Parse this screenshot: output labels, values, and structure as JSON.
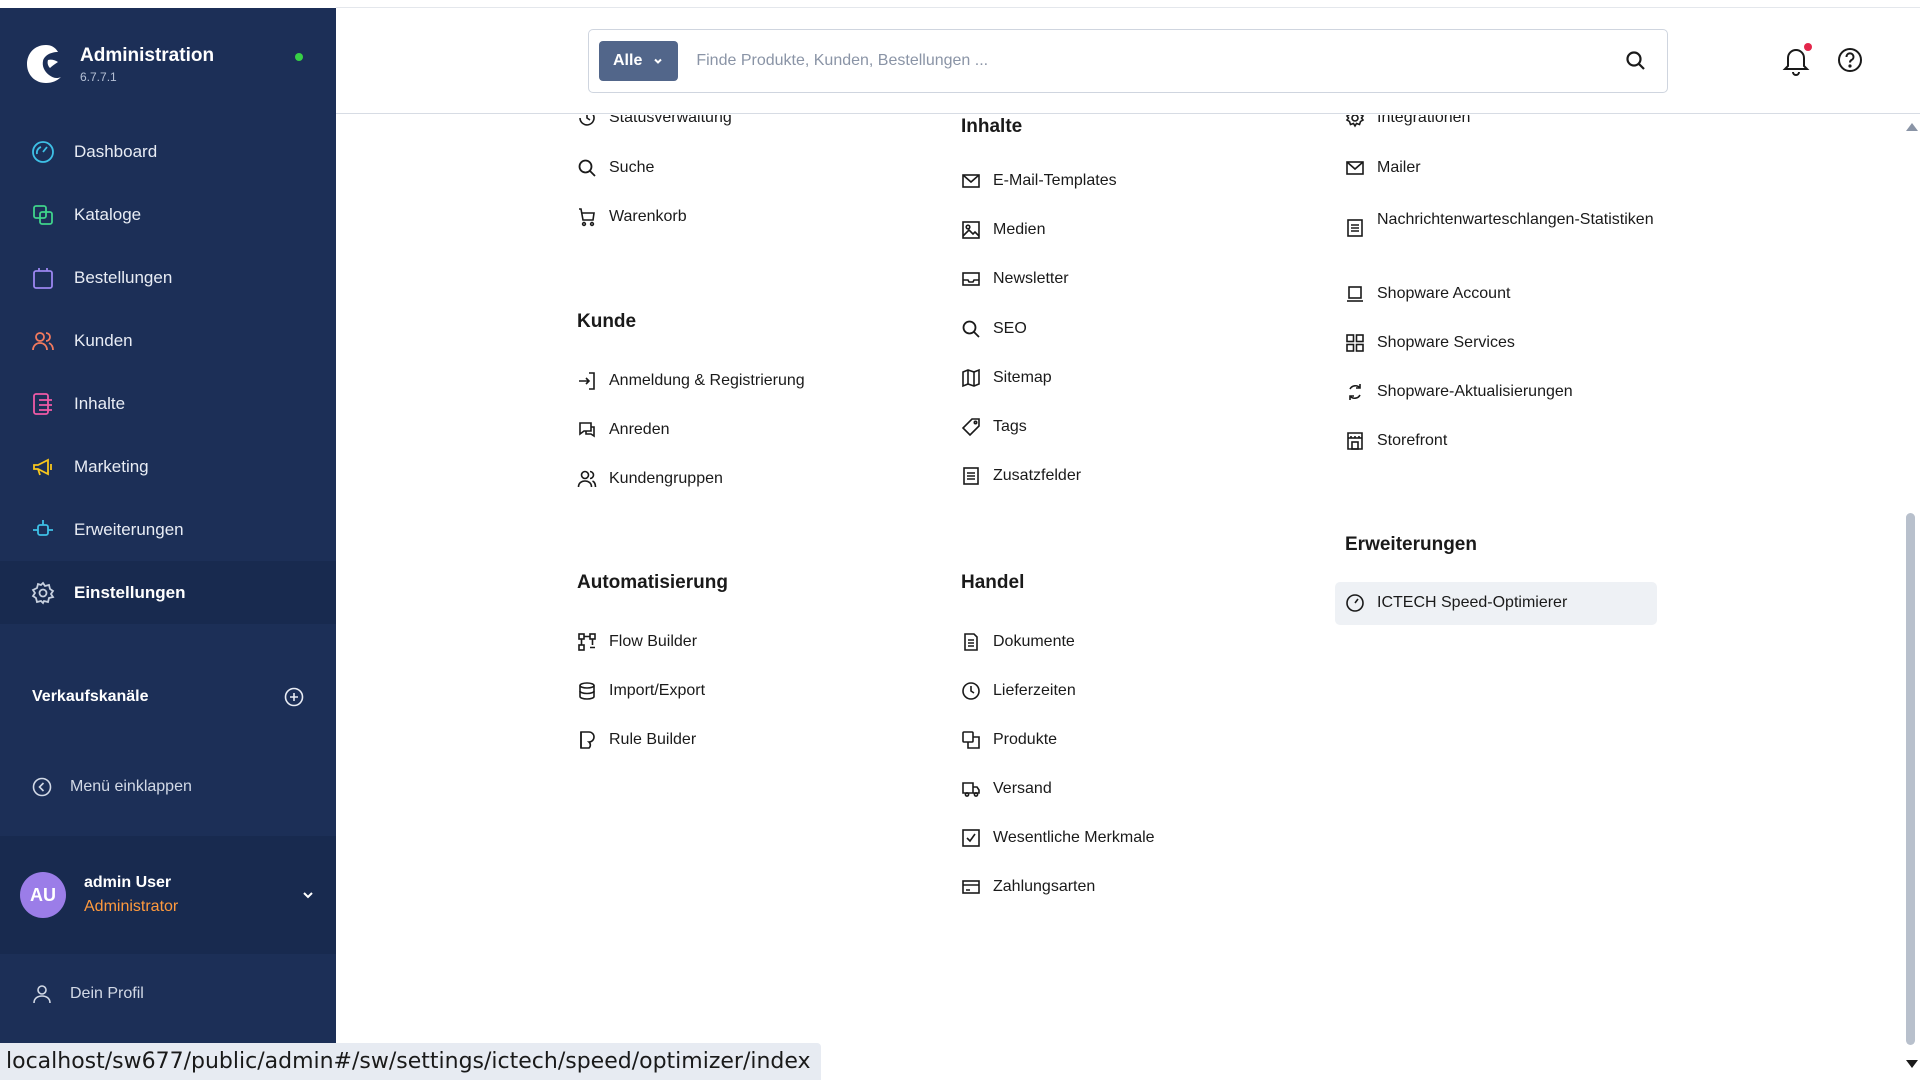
{
  "app": {
    "title": "Administration",
    "version": "6.7.7.1"
  },
  "nav": [
    {
      "label": "Dashboard",
      "icon": "dashboard-icon"
    },
    {
      "label": "Kataloge",
      "icon": "catalog-icon"
    },
    {
      "label": "Bestellungen",
      "icon": "orders-icon"
    },
    {
      "label": "Kunden",
      "icon": "customers-icon"
    },
    {
      "label": "Inhalte",
      "icon": "content-icon"
    },
    {
      "label": "Marketing",
      "icon": "marketing-icon"
    },
    {
      "label": "Erweiterungen",
      "icon": "extensions-icon"
    },
    {
      "label": "Einstellungen",
      "icon": "settings-icon",
      "active": true
    }
  ],
  "sidebar": {
    "channels_label": "Verkaufskanäle",
    "collapse_label": "Menü einklappen",
    "profile_label": "Dein Profil"
  },
  "user": {
    "initials": "AU",
    "name": "admin User",
    "role": "Administrator"
  },
  "search": {
    "filter_label": "Alle",
    "placeholder": "Finde Produkte, Kunden, Bestellungen ..."
  },
  "settings": {
    "col1": {
      "top_items": [
        "Statusverwaltung",
        "Suche",
        "Warenkorb"
      ],
      "kunde_title": "Kunde",
      "kunde_items": [
        "Anmeldung & Registrierung",
        "Anreden",
        "Kundengruppen"
      ],
      "auto_title": "Automatisierung",
      "auto_items": [
        "Flow Builder",
        "Import/Export",
        "Rule Builder"
      ]
    },
    "col2": {
      "inhalte_title": "Inhalte",
      "inhalte_items": [
        "E-Mail-Templates",
        "Medien",
        "Newsletter",
        "SEO",
        "Sitemap",
        "Tags",
        "Zusatzfelder"
      ],
      "handel_title": "Handel",
      "handel_items": [
        "Dokumente",
        "Lieferzeiten",
        "Produkte",
        "Versand",
        "Wesentliche Merkmale",
        "Zahlungsarten"
      ]
    },
    "col3": {
      "top_items": [
        "Integrationen",
        "Mailer",
        "Nachrichtenwarteschlangen-Statistiken",
        "Shopware Account",
        "Shopware Services",
        "Shopware-Aktualisierungen",
        "Storefront"
      ],
      "ext_title": "Erweiterungen",
      "ext_items": [
        "ICTECH Speed-Optimierer"
      ]
    }
  },
  "status_url": "localhost/sw677/public/admin#/sw/settings/ictech/speed/optimizer/index",
  "colors": {
    "sidebar_bg": "#1c2f57",
    "online": "#37d046",
    "role": "#ff9a3d",
    "avatar": "#9b7de8",
    "notification": "#e3264b"
  }
}
